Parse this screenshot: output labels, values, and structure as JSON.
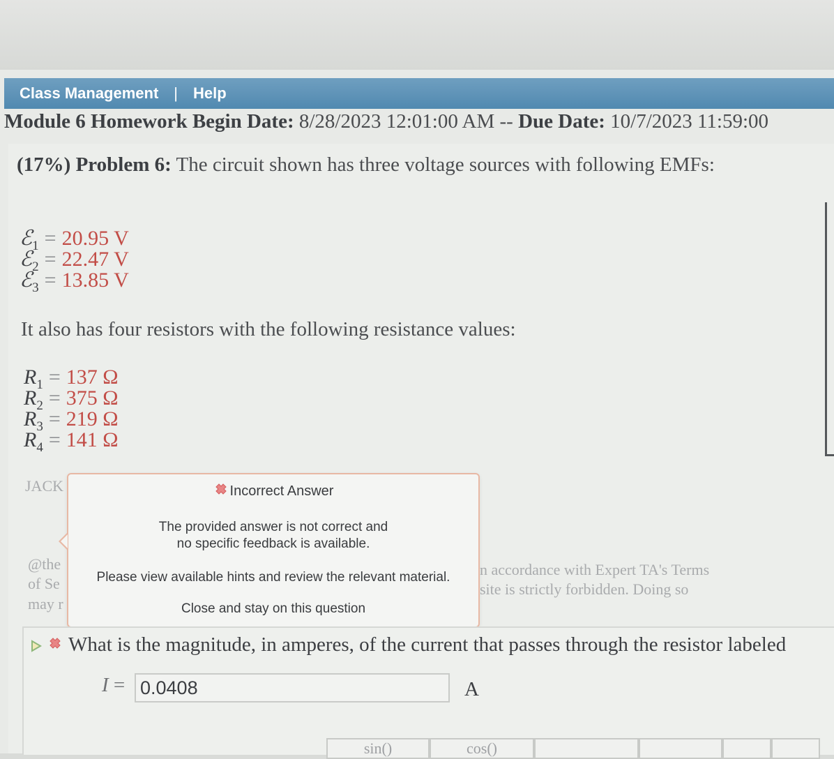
{
  "nav": {
    "class_management": "Class Management",
    "separator": "|",
    "help": "Help"
  },
  "module": {
    "name": "Module 6 Homework",
    "begin_label": "Begin Date:",
    "begin_date": "8/28/2023 12:01:00 AM",
    "dash": "--",
    "due_label": "Due Date:",
    "due_date": "10/7/2023 11:59:00"
  },
  "problem": {
    "percent": "(17%)",
    "label": "Problem 6:",
    "text": "The circuit shown has three voltage sources with following EMFs:"
  },
  "emfs": [
    {
      "symbol": "ℰ",
      "sub": "1",
      "value": "20.95",
      "unit": "V"
    },
    {
      "symbol": "ℰ",
      "sub": "2",
      "value": "22.47",
      "unit": "V"
    },
    {
      "symbol": "ℰ",
      "sub": "3",
      "value": "13.85",
      "unit": "V"
    }
  ],
  "resistors_intro": "It also has four resistors with the following resistance values:",
  "resistors": [
    {
      "symbol": "R",
      "sub": "1",
      "value": "137",
      "unit": "Ω"
    },
    {
      "symbol": "R",
      "sub": "2",
      "value": "375",
      "unit": "Ω"
    },
    {
      "symbol": "R",
      "sub": "3",
      "value": "219",
      "unit": "Ω"
    },
    {
      "symbol": "R",
      "sub": "4",
      "value": "141",
      "unit": "Ω"
    }
  ],
  "faded": {
    "jack": "JACK",
    "the": "@the",
    "of_se": "of Se",
    "may": "may r",
    "terms_line1": "n accordance with Expert TA's Terms",
    "terms_line2": "site is strictly forbidden. Doing so"
  },
  "tooltip": {
    "title": "Incorrect Answer",
    "message_line1": "The provided answer is not correct and",
    "message_line2": "no specific feedback is available.",
    "hint": "Please view available hints and review the relevant material.",
    "close": "Close and stay on this question"
  },
  "question": {
    "text": "What is the magnitude, in amperes, of the current that passes through the resistor labeled",
    "variable": "I",
    "equals": "=",
    "answer": "0.0408",
    "unit": "A"
  },
  "keypad": {
    "sin": "sin()",
    "cos": "cos()"
  },
  "colors": {
    "nav_bg": "#5a8fb5",
    "value_red": "#c24d47",
    "tooltip_border": "#e8b8a4",
    "error_icon": "#e06b6b"
  }
}
